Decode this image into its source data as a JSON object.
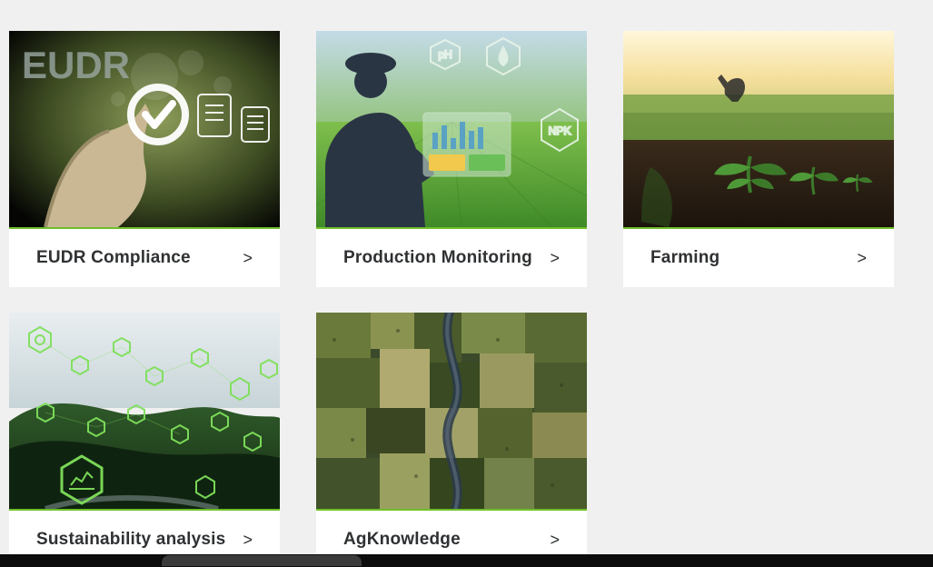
{
  "cards": [
    {
      "label": "EUDR Compliance"
    },
    {
      "label": "Production Monitoring"
    },
    {
      "label": "Farming"
    },
    {
      "label": "Sustainability analysis"
    },
    {
      "label": "AgKnowledge"
    }
  ],
  "chevron_glyph": ">",
  "image_overlays": {
    "card0_text": "EUDR",
    "card1_badges": [
      "pH",
      "NPK"
    ]
  },
  "colors": {
    "background": "#f0f0f0",
    "accent": "#6fbf2a",
    "card_bg": "#ffffff",
    "text": "#2f3133"
  }
}
